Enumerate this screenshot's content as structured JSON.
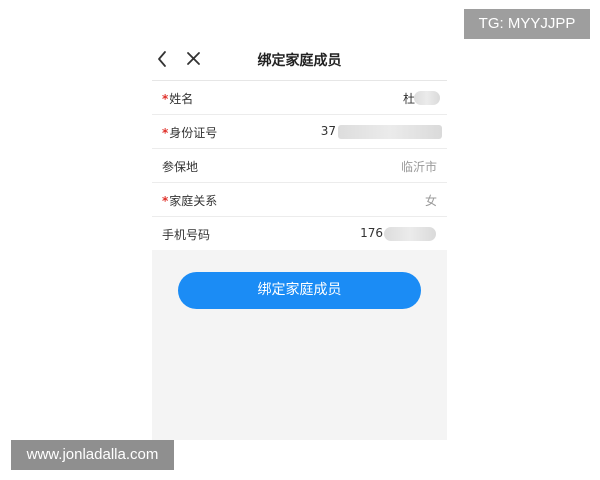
{
  "header": {
    "title": "绑定家庭成员",
    "back_icon": "chevron-left-icon",
    "close_icon": "close-icon"
  },
  "form": {
    "rows": [
      {
        "label": "姓名",
        "required": true,
        "value": "杜"
      },
      {
        "label": "身份证号",
        "required": true,
        "value": "37"
      },
      {
        "label": "参保地",
        "required": false,
        "value": "临沂市"
      },
      {
        "label": "家庭关系",
        "required": true,
        "value": "女"
      },
      {
        "label": "手机号码",
        "required": false,
        "value": "176"
      }
    ],
    "required_mark": "*"
  },
  "submit": {
    "label": "绑定家庭成员"
  },
  "watermarks": {
    "top_right": "TG: MYYJJPP",
    "bottom_left": "www.jonladalla.com"
  },
  "colors": {
    "accent": "#1b8cf5",
    "required": "#e0322b",
    "background": "#f4f4f4"
  }
}
